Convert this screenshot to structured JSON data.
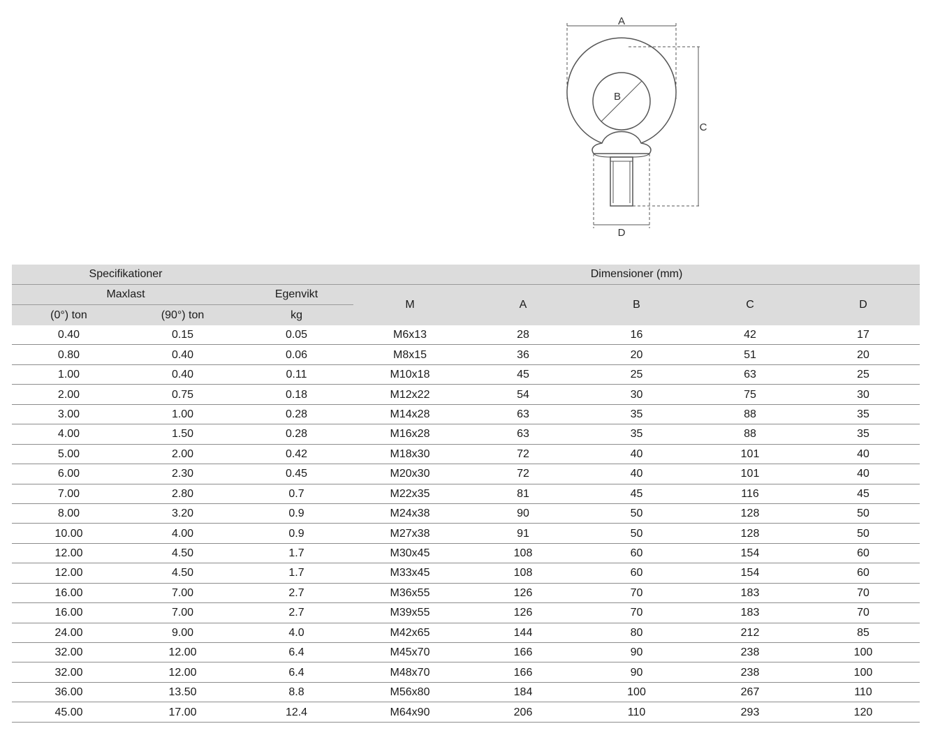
{
  "figure": {
    "label_a": "A",
    "label_b": "B",
    "label_c": "C",
    "label_d": "D"
  },
  "table": {
    "header": {
      "spec_group": "Specifikationer",
      "dim_group": "Dimensioner (mm)",
      "maxlast": "Maxlast",
      "egenvikt": "Egenvikt",
      "col_0": "(0°) ton",
      "col_90": "(90°) ton",
      "col_kg": "kg",
      "col_m": "M",
      "col_a": "A",
      "col_b": "B",
      "col_c": "C",
      "col_d": "D"
    },
    "rows": [
      [
        "0.40",
        "0.15",
        "0.05",
        "M6x13",
        "28",
        "16",
        "42",
        "17"
      ],
      [
        "0.80",
        "0.40",
        "0.06",
        "M8x15",
        "36",
        "20",
        "51",
        "20"
      ],
      [
        "1.00",
        "0.40",
        "0.11",
        "M10x18",
        "45",
        "25",
        "63",
        "25"
      ],
      [
        "2.00",
        "0.75",
        "0.18",
        "M12x22",
        "54",
        "30",
        "75",
        "30"
      ],
      [
        "3.00",
        "1.00",
        "0.28",
        "M14x28",
        "63",
        "35",
        "88",
        "35"
      ],
      [
        "4.00",
        "1.50",
        "0.28",
        "M16x28",
        "63",
        "35",
        "88",
        "35"
      ],
      [
        "5.00",
        "2.00",
        "0.42",
        "M18x30",
        "72",
        "40",
        "101",
        "40"
      ],
      [
        "6.00",
        "2.30",
        "0.45",
        "M20x30",
        "72",
        "40",
        "101",
        "40"
      ],
      [
        "7.00",
        "2.80",
        "0.7",
        "M22x35",
        "81",
        "45",
        "116",
        "45"
      ],
      [
        "8.00",
        "3.20",
        "0.9",
        "M24x38",
        "90",
        "50",
        "128",
        "50"
      ],
      [
        "10.00",
        "4.00",
        "0.9",
        "M27x38",
        "91",
        "50",
        "128",
        "50"
      ],
      [
        "12.00",
        "4.50",
        "1.7",
        "M30x45",
        "108",
        "60",
        "154",
        "60"
      ],
      [
        "12.00",
        "4.50",
        "1.7",
        "M33x45",
        "108",
        "60",
        "154",
        "60"
      ],
      [
        "16.00",
        "7.00",
        "2.7",
        "M36x55",
        "126",
        "70",
        "183",
        "70"
      ],
      [
        "16.00",
        "7.00",
        "2.7",
        "M39x55",
        "126",
        "70",
        "183",
        "70"
      ],
      [
        "24.00",
        "9.00",
        "4.0",
        "M42x65",
        "144",
        "80",
        "212",
        "85"
      ],
      [
        "32.00",
        "12.00",
        "6.4",
        "M45x70",
        "166",
        "90",
        "238",
        "100"
      ],
      [
        "32.00",
        "12.00",
        "6.4",
        "M48x70",
        "166",
        "90",
        "238",
        "100"
      ],
      [
        "36.00",
        "13.50",
        "8.8",
        "M56x80",
        "184",
        "100",
        "267",
        "110"
      ],
      [
        "45.00",
        "17.00",
        "12.4",
        "M64x90",
        "206",
        "110",
        "293",
        "120"
      ]
    ]
  }
}
